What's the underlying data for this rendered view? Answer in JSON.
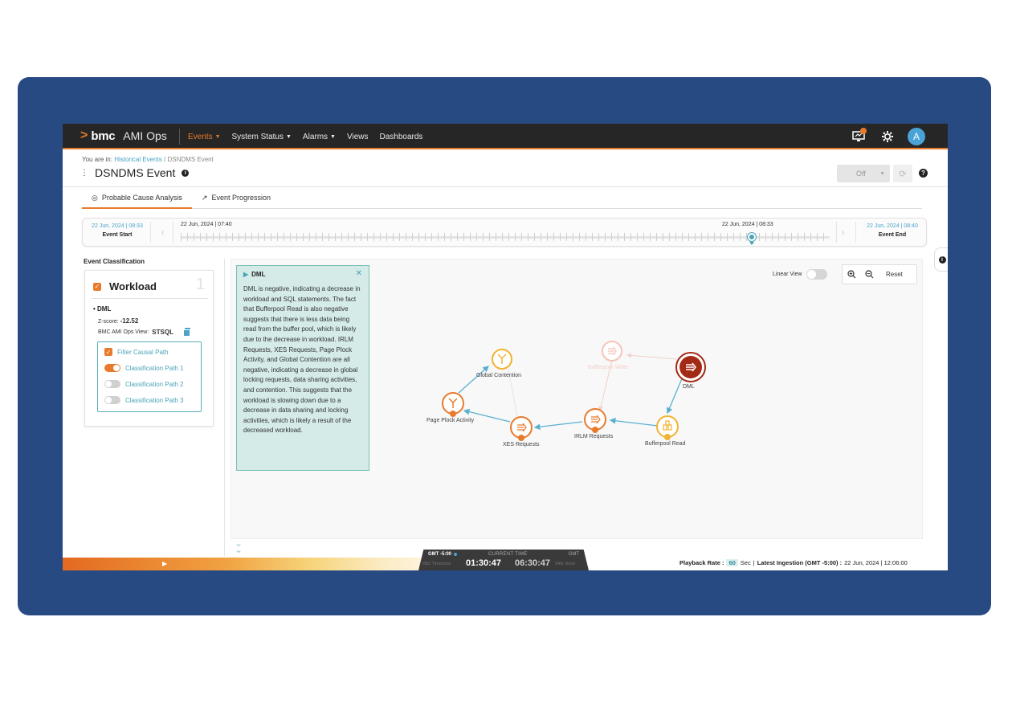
{
  "nav": {
    "brand": "bmc",
    "product": "AMI Ops",
    "menu": [
      {
        "label": "Events",
        "active": true,
        "caret": true
      },
      {
        "label": "System Status",
        "active": false,
        "caret": true
      },
      {
        "label": "Alarms",
        "active": false,
        "caret": true
      },
      {
        "label": "Views",
        "active": false,
        "caret": false
      },
      {
        "label": "Dashboards",
        "active": false,
        "caret": false
      }
    ],
    "avatar_initial": "A",
    "icons": [
      "monitor-notification-icon",
      "gear-icon"
    ]
  },
  "breadcrumb": {
    "prefix": "You are in:",
    "parent": "Historical Events",
    "separator": "/",
    "current": "DSNDMS Event"
  },
  "page": {
    "title": "DSNDMS Event",
    "refresh_select": "Off"
  },
  "tabs": [
    {
      "label": "Probable Cause Analysis",
      "active": true,
      "icon": "radar-icon"
    },
    {
      "label": "Event Progression",
      "active": false,
      "icon": "trend-icon"
    }
  ],
  "timeline": {
    "start_date": "22 Jun, 2024 | 08:33",
    "start_label": "Event Start",
    "track_left": "22 Jun, 2024 | 07:40",
    "track_marker": "22 Jun, 2024 | 08:33",
    "end_date": "22 Jun, 2024 | 08:40",
    "end_label": "Event End"
  },
  "classification": {
    "title": "Event Classification",
    "category": "Workload",
    "count": "1",
    "item": "DML",
    "zscore_label": "Z-score:",
    "zscore": "-12.52",
    "view_label": "BMC AMI Ops View:",
    "view": "STSQL",
    "filter_label": "Filter Causal Path",
    "paths": [
      {
        "label": "Classification Path 1",
        "on": true
      },
      {
        "label": "Classification Path 2",
        "on": false
      },
      {
        "label": "Classification Path 3",
        "on": false
      }
    ]
  },
  "popup": {
    "title": "DML",
    "body": "DML is negative, indicating a decrease in workload and SQL statements. The fact that Bufferpool Read is also negative suggests that there is less data being read from the buffer pool, which is likely due to the decrease in workload. IRLM Requests, XES Requests, Page Plock Activity, and Global Contention are all negative, indicating a decrease in global locking requests, data sharing activities, and contention. This suggests that the workload is slowing down due to a decrease in data sharing and locking activities, which is likely a result of the decreased workload."
  },
  "graph_controls": {
    "linear_view": "Linear View",
    "reset": "Reset"
  },
  "graph": {
    "nodes": [
      {
        "id": "dml",
        "label": "DML",
        "color": "#a32a14",
        "icon": "arrows-icon"
      },
      {
        "id": "bufferpool_write",
        "label": "Bufferpool Write",
        "color": "#f3b8a8",
        "icon": "arrows-icon"
      },
      {
        "id": "global_contention",
        "label": "Global Contention",
        "color": "#f2b233",
        "icon": "merge-icon"
      },
      {
        "id": "page_plock",
        "label": "Page Plock Activity",
        "color": "#e87a2c",
        "icon": "merge-icon"
      },
      {
        "id": "xes",
        "label": "XES Requests",
        "color": "#e87a2c",
        "icon": "arrows-icon"
      },
      {
        "id": "irlm",
        "label": "IRLM Requests",
        "color": "#e87a2c",
        "icon": "arrows-icon"
      },
      {
        "id": "bufferpool_read",
        "label": "Bufferpool Read",
        "color": "#f2b233",
        "icon": "database-icon"
      }
    ]
  },
  "footer": {
    "tz_label": "GMT -5:00",
    "current_label": "CURRENT TIME",
    "gmt_label": "GMT",
    "tz_sub": "Db2 Timezone",
    "time_local": "01:30:47",
    "time_gmt": "06:30:47",
    "clock_sub": "24hr clock",
    "playback_label": "Playback Rate :",
    "playback_rate": "60",
    "playback_unit": "Sec",
    "separator": "|",
    "ingestion_label": "Latest Ingestion (GMT -5:00) :",
    "ingestion_value": "22 Jun, 2024 | 12:06:00"
  },
  "colors": {
    "accent": "#e87a2c",
    "teal": "#4aa3b8",
    "frame": "#284a82",
    "nav_bg": "#262626"
  }
}
